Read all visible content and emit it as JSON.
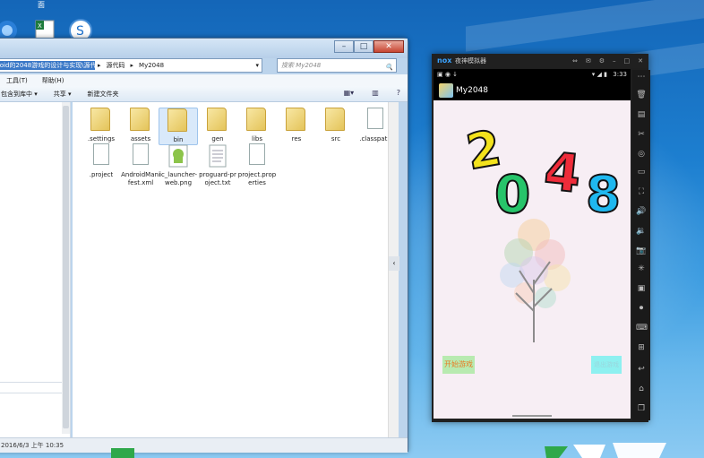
{
  "desktop": {
    "icon_label_top": "面"
  },
  "explorer": {
    "address_segments": [
      "roid的2048游戏的设计与实现\\源代码",
      "源代码",
      "My2048"
    ],
    "search_placeholder": "搜索 My2048",
    "menu": [
      "工具(T)",
      "帮助(H)"
    ],
    "toolbar": [
      "包含到库中 ▾",
      "共享 ▾",
      "新建文件夹"
    ],
    "files_row1": [
      {
        "name": ".settings",
        "kind": "folder"
      },
      {
        "name": "assets",
        "kind": "folder"
      },
      {
        "name": "bin",
        "kind": "folder",
        "selected": true
      },
      {
        "name": "gen",
        "kind": "folder"
      },
      {
        "name": "libs",
        "kind": "folder"
      },
      {
        "name": "res",
        "kind": "folder"
      },
      {
        "name": "src",
        "kind": "folder"
      },
      {
        "name": ".classpath",
        "kind": "doc"
      }
    ],
    "files_row2": [
      {
        "name": ".project",
        "kind": "doc"
      },
      {
        "name": "AndroidManifest.xml",
        "kind": "doc"
      },
      {
        "name": "ic_launcher-web.png",
        "kind": "android"
      },
      {
        "name": "proguard-project.txt",
        "kind": "txt"
      },
      {
        "name": "project.properties",
        "kind": "doc"
      }
    ],
    "status_text": "2016/6/3 上午 10:35"
  },
  "nox": {
    "logo": "nox",
    "title": "夜神模拟器",
    "status_time": "3:33",
    "app_title": "My2048",
    "digits": [
      {
        "char": "2",
        "color": "#f3e21c"
      },
      {
        "char": "0",
        "color": "#27c46a"
      },
      {
        "char": "4",
        "color": "#ee2c3a"
      },
      {
        "char": "8",
        "color": "#1fb8ef"
      }
    ],
    "btn_start": "开始游戏",
    "btn_exit": "退出游戏"
  }
}
